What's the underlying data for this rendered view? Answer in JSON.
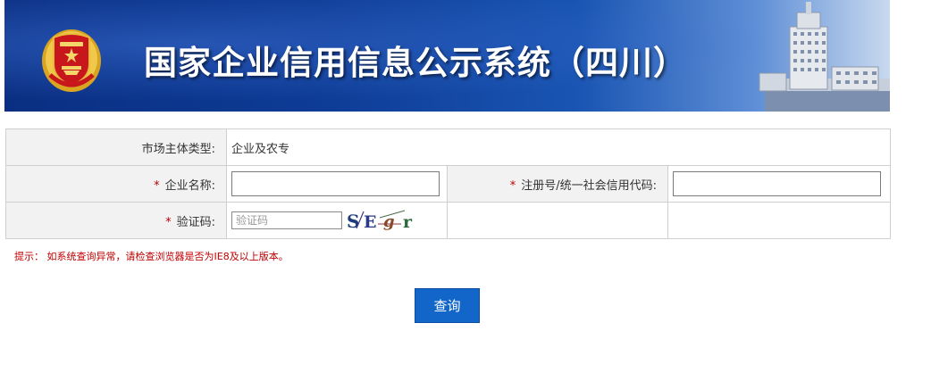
{
  "header": {
    "title": "国家企业信用信息公示系统（四川）",
    "emblem_icon": "national-emblem-icon",
    "building_image": "building-icon"
  },
  "form": {
    "market_type_label": "市场主体类型:",
    "market_type_value": "企业及农专",
    "required_mark": "*",
    "company_name_label": "企业名称:",
    "company_name_value": "",
    "reg_no_label": "注册号/统一社会信用代码:",
    "reg_no_value": "",
    "captcha_label": "验证码:",
    "captcha_placeholder": "验证码",
    "captcha_value": "",
    "captcha_chars": [
      "S",
      "E",
      "g",
      "r"
    ]
  },
  "tip": "提示： 如系统查询异常，请检查浏览器是否为IE8及以上版本。",
  "query_button": "查询",
  "colors": {
    "banner_dark": "#0a2f82",
    "banner_light": "#c9d9ef",
    "button": "#1366c9",
    "required": "#c00000",
    "label_bg": "#f2f2f2"
  }
}
